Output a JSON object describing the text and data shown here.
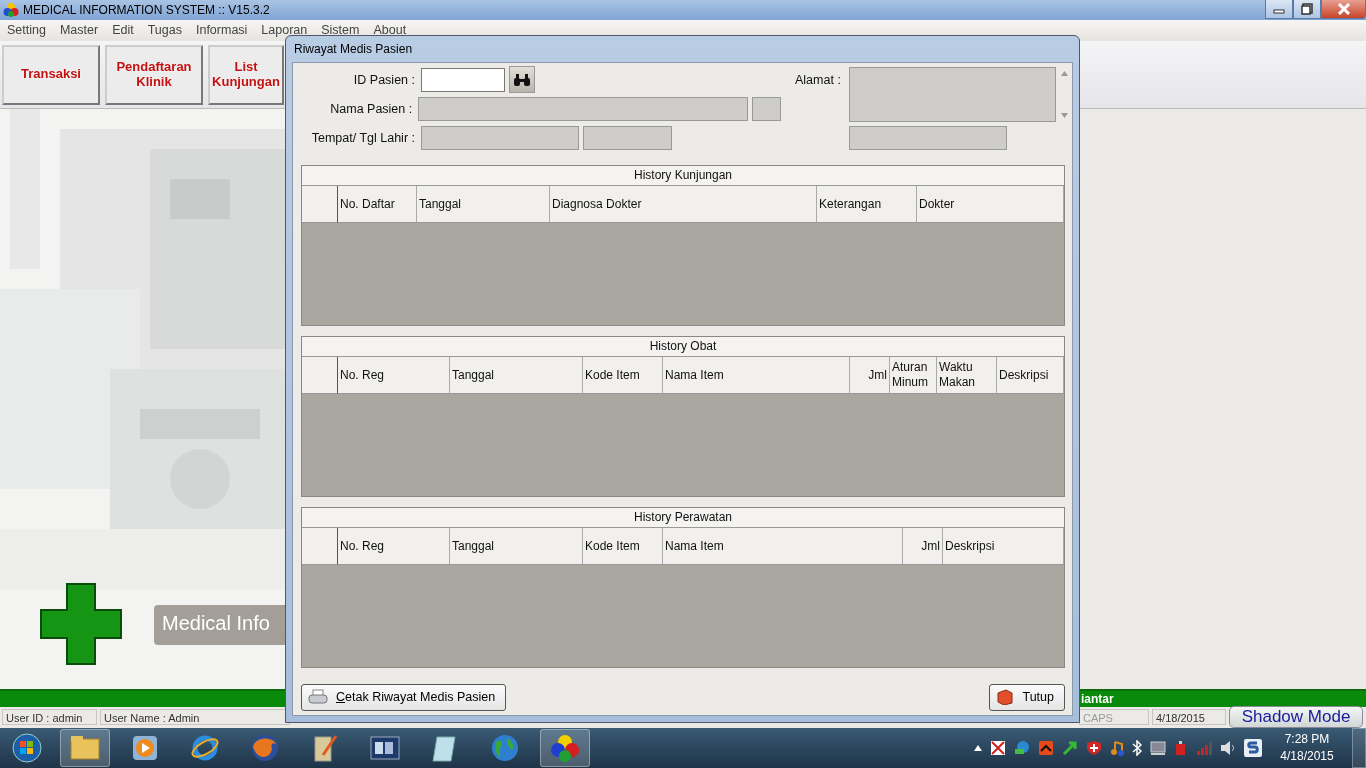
{
  "window": {
    "title": "MEDICAL INFORMATION SYSTEM :: V15.3.2"
  },
  "menu": [
    {
      "label": "Setting"
    },
    {
      "label": "Master"
    },
    {
      "label": "Edit"
    },
    {
      "label": "Tugas"
    },
    {
      "label": "Informasi"
    },
    {
      "label": "Laporan"
    },
    {
      "label": "Sistem"
    },
    {
      "label": "About"
    }
  ],
  "toolbar": [
    {
      "label": "Transaksi"
    },
    {
      "label": "Pendaftaran Klinik"
    },
    {
      "label": "List Kunjungan"
    }
  ],
  "banner": {
    "text": "Medical Info"
  },
  "status_bar": {
    "message": "iantar",
    "user_id": "User ID : admin",
    "user_name": "User Name : Admin",
    "caps": "CAPS",
    "date": "4/18/2015",
    "shadow_button": "Shadow Mode"
  },
  "dialog": {
    "title": "Riwayat Medis Pasien",
    "fields": [
      {
        "label": "ID Pasien :",
        "boxes": [
          {
            "disabled": false
          }
        ]
      },
      {
        "label": "Nama Pasien :",
        "boxes": [
          {
            "disabled": true
          },
          {
            "disabled": true
          }
        ]
      },
      {
        "label": "Tempat/ Tgl Lahir :",
        "boxes": [
          {
            "disabled": true
          },
          {
            "disabled": true
          }
        ]
      },
      {
        "label": "Alamat :",
        "boxes": [
          {
            "disabled": true
          },
          {
            "disabled": true
          }
        ]
      }
    ],
    "grids": [
      {
        "title": "History Kunjungan",
        "columns": [
          "No. Daftar",
          "Tanggal",
          "Diagnosa Dokter",
          "Keterangan",
          "Dokter"
        ]
      },
      {
        "title": "History Obat",
        "columns": [
          "No. Reg",
          "Tanggal",
          "Kode Item",
          "Nama Item",
          "Jml",
          "Aturan Minum",
          "Waktu Makan",
          "Deskripsi"
        ]
      },
      {
        "title": "History Perawatan",
        "columns": [
          "No. Reg",
          "Tanggal",
          "Kode Item",
          "Nama Item",
          "Jml",
          "Deskripsi"
        ]
      }
    ],
    "print_button": "Cetak Riwayat Medis Pasien",
    "close_button": "Tutup"
  },
  "taskbar": {
    "clock_time": "7:28 PM",
    "clock_date": "4/18/2015"
  }
}
